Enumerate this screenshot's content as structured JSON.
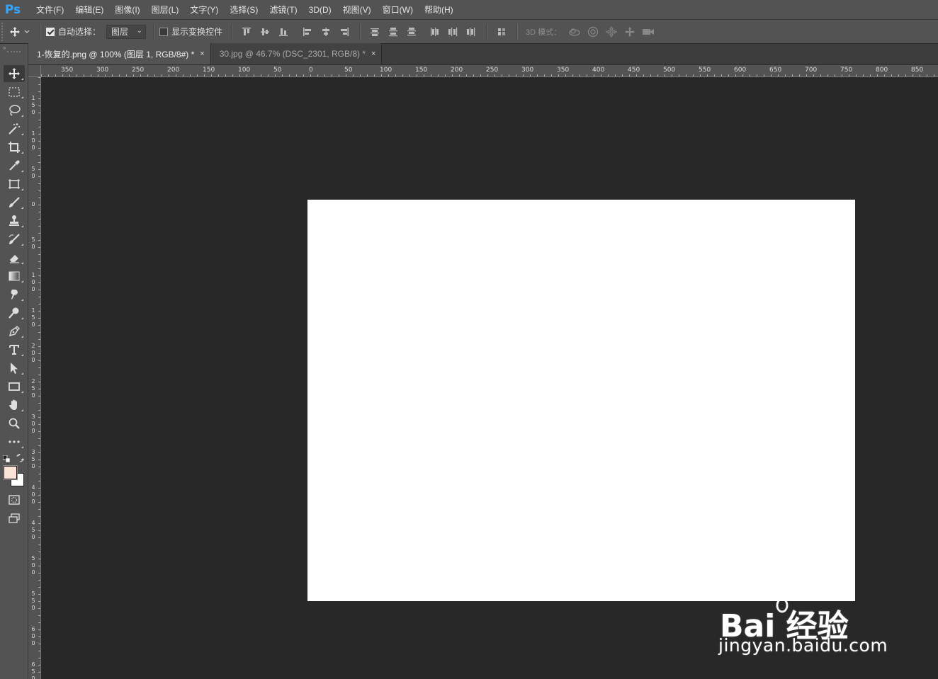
{
  "app": {
    "logo": "Ps"
  },
  "menu": [
    "文件(F)",
    "编辑(E)",
    "图像(I)",
    "图层(L)",
    "文字(Y)",
    "选择(S)",
    "滤镜(T)",
    "3D(D)",
    "视图(V)",
    "窗口(W)",
    "帮助(H)"
  ],
  "options": {
    "auto_select_label": "自动选择：",
    "auto_select_checked": true,
    "auto_select_target": "图层",
    "show_transform_label": "显示变换控件",
    "show_transform_checked": false,
    "mode_3d_label": "3D 模式："
  },
  "tabs": [
    {
      "label": "1-恢复的.png @ 100% (图层 1, RGB/8#) *",
      "close": "×",
      "active": true
    },
    {
      "label": "30.jpg @ 46.7% (DSC_2301, RGB/8) *",
      "close": "×",
      "active": false
    }
  ],
  "ruler_top": [
    "350",
    "300",
    "250",
    "200",
    "150",
    "100",
    "50",
    "0",
    "50",
    "100",
    "150",
    "200",
    "250",
    "300",
    "350",
    "400",
    "450",
    "500",
    "550",
    "600",
    "650",
    "700",
    "750",
    "800",
    "850"
  ],
  "ruler_left": [
    "150",
    "100",
    "50",
    "0",
    "50",
    "100",
    "150",
    "200",
    "250",
    "300",
    "350",
    "400",
    "450",
    "500",
    "550",
    "600",
    "650"
  ],
  "colors": {
    "foreground": "#fbe3d7",
    "background": "#ffffff",
    "document": "#ffffff",
    "workspace": "#282828",
    "panel": "#535353"
  },
  "watermark": {
    "logo_text": "Bai 经验",
    "url_text": "jingyan.baidu.com"
  }
}
